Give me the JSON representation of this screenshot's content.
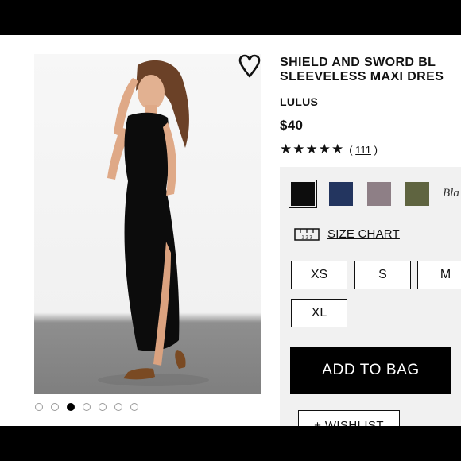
{
  "product": {
    "title_line1": "SHIELD AND SWORD BL",
    "title_line2": "SLEEVELESS MAXI DRES",
    "brand": "LULUS",
    "price": "$40",
    "rating": {
      "stars": "★★★★★",
      "open_paren": "(",
      "count": "111",
      "close_paren": ")"
    }
  },
  "gallery": {
    "image_count": 7,
    "active_index": 2,
    "icons": {
      "favorite": "heart-outline-icon"
    }
  },
  "colors": {
    "swatches": [
      {
        "name": "black",
        "hex": "#0d0d0d",
        "selected": true
      },
      {
        "name": "navy",
        "hex": "#23355f",
        "selected": false
      },
      {
        "name": "taupe",
        "hex": "#8e7f86",
        "selected": false
      },
      {
        "name": "olive",
        "hex": "#5f6440",
        "selected": false
      }
    ],
    "selected_label": "Bla"
  },
  "size_chart": {
    "icon_text": "1 2 3",
    "label": "SIZE CHART"
  },
  "sizes": [
    "XS",
    "S",
    "M",
    "XL"
  ],
  "actions": {
    "add_to_bag": "ADD TO BAG",
    "wishlist": "+ WISHLIST"
  },
  "theme": {
    "accent": "#000000",
    "panel_bg": "#f1f1f1"
  }
}
